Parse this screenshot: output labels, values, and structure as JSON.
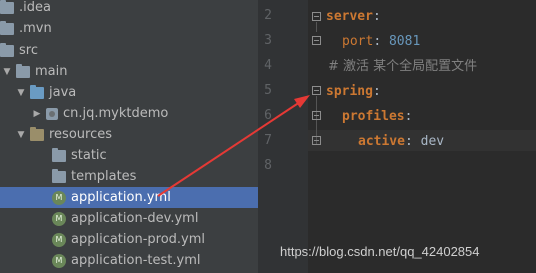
{
  "project_tree": {
    "items": [
      {
        "label": ".idea",
        "icon": "folder-icon"
      },
      {
        "label": ".mvn",
        "icon": "folder-icon"
      },
      {
        "label": "src",
        "icon": "folder-icon"
      },
      {
        "label": "main",
        "icon": "folder-icon"
      },
      {
        "label": "java",
        "icon": "source-folder-icon"
      },
      {
        "label": "cn.jq.myktdemo",
        "icon": "package-icon"
      },
      {
        "label": "resources",
        "icon": "resources-folder-icon"
      },
      {
        "label": "static",
        "icon": "folder-icon"
      },
      {
        "label": "templates",
        "icon": "folder-icon"
      },
      {
        "label": "application.yml",
        "icon": "spring-config-icon",
        "selected": true
      },
      {
        "label": "application-dev.yml",
        "icon": "spring-config-icon"
      },
      {
        "label": "application-prod.yml",
        "icon": "spring-config-icon"
      },
      {
        "label": "application-test.yml",
        "icon": "spring-config-icon"
      }
    ]
  },
  "editor": {
    "line_numbers": [
      "2",
      "3",
      "4",
      "5",
      "6",
      "7",
      "8"
    ],
    "lines": {
      "l2": {
        "key": "server",
        "colon": ":"
      },
      "l3": {
        "key": "port",
        "colon": ": ",
        "value": "8081"
      },
      "l4": {
        "comment": "# 激活 某个全局配置文件"
      },
      "l5": {
        "key": "spring",
        "colon": ":"
      },
      "l6": {
        "key": "profiles",
        "colon": ":"
      },
      "l7": {
        "key": "active",
        "colon": ": ",
        "value": "dev"
      }
    }
  },
  "watermark": "https://blog.csdn.net/qq_42402854",
  "colors": {
    "annotation_arrow": "#e53935",
    "selection": "#4b6eaf"
  }
}
